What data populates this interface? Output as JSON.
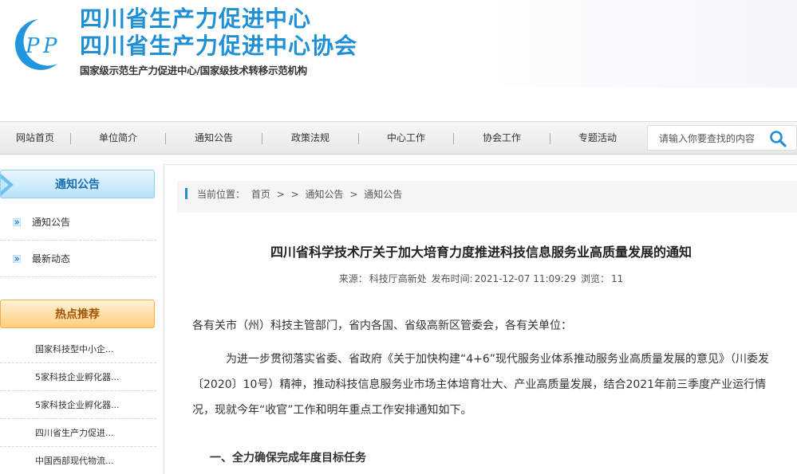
{
  "header": {
    "title1": "四川省生产力促进中心",
    "title2": "四川省生产力促进中心协会",
    "subtitle": "国家级示范生产力促进中心/国家级技术转移示范机构",
    "logo_text": "CPP",
    "brand_color": "#1f8fd6"
  },
  "nav": {
    "items": [
      "网站首页",
      "单位简介",
      "通知公告",
      "政策法规",
      "中心工作",
      "协会工作",
      "专题活动"
    ],
    "search_placeholder": "请输入你要查找的内容"
  },
  "sidebar": {
    "section1_title": "通知公告",
    "section1_items": [
      "通知公告",
      "最新动态"
    ],
    "section2_title": "热点推荐",
    "section2_items": [
      "国家科技型中小企...",
      "5家科技企业孵化器...",
      "5家科技企业孵化器...",
      "四川省生产力促进...",
      "中国西部现代物流..."
    ]
  },
  "breadcrumb": {
    "label": "当前位置：",
    "items": [
      "首页",
      ">",
      ">",
      "通知公告",
      ">",
      "通知公告"
    ]
  },
  "article": {
    "title": "四川省科学技术厅关于加大培育力度推进科技信息服务业高质量发展的通知",
    "source_label": "来源：",
    "source": "科技厅高新处",
    "time_label": "发布时间:",
    "time": "2021-12-07 11:09:29",
    "views_label": "浏览：",
    "views": "11",
    "p1": "各有关市（州）科技主管部门，省内各国、省级高新区管委会，各有关单位：",
    "p2": "为进一步贯彻落实省委、省政府《关于加快构建“4+6”现代服务业体系推动服务业高质量发展的意见》（川委发〔2020〕10号）精神，推动科技信息服务业市场主体培育壮大、产业高质量发展，结合2021年前三季度产业运行情况，现就今年“收官”工作和明年重点工作安排通知如下。",
    "h1": "一、全力确保完成年度目标任务"
  }
}
